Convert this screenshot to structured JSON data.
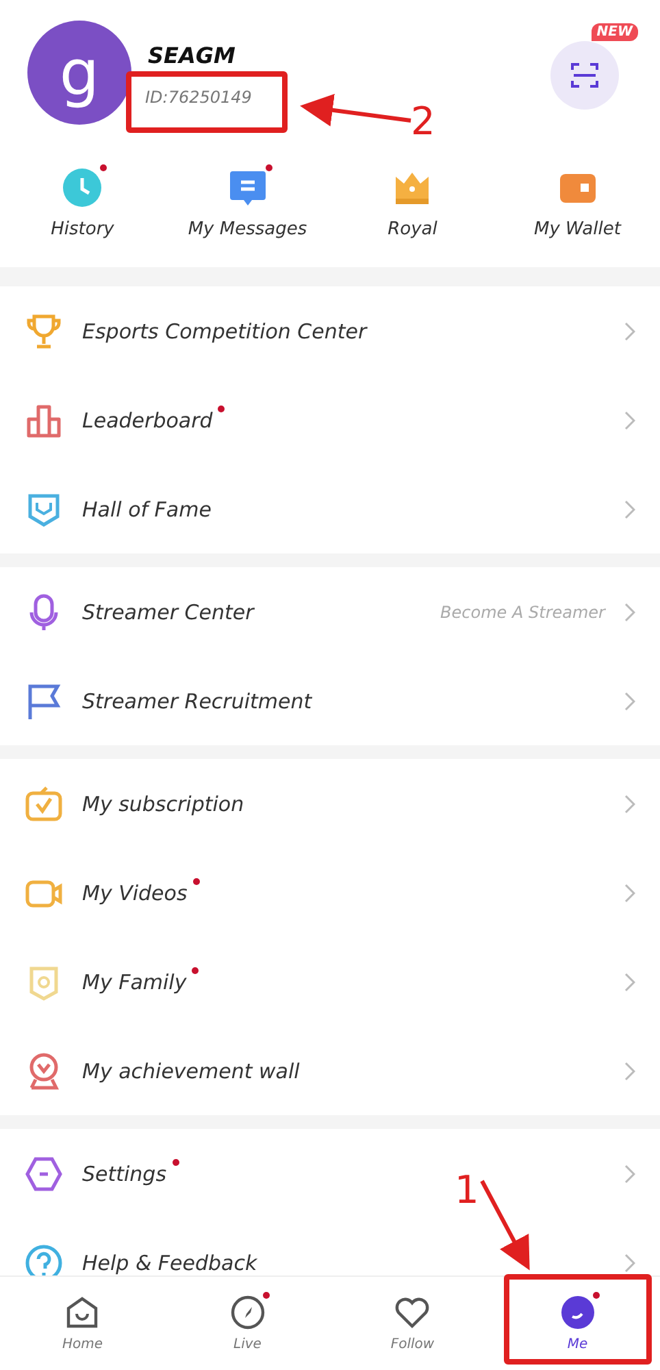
{
  "profile": {
    "avatar_letter": "g",
    "name": "SEAGM",
    "id": "ID:76250149",
    "scan_badge": "NEW"
  },
  "quick_actions": [
    {
      "label": "History",
      "dot": true
    },
    {
      "label": "My Messages",
      "dot": true
    },
    {
      "label": "Royal",
      "dot": false
    },
    {
      "label": "My Wallet",
      "dot": false
    }
  ],
  "menu_groups": [
    {
      "items": [
        {
          "label": "Esports Competition Center",
          "dot": false
        },
        {
          "label": "Leaderboard",
          "dot": true
        },
        {
          "label": "Hall of Fame",
          "dot": false
        }
      ]
    },
    {
      "items": [
        {
          "label": "Streamer Center",
          "dot": false,
          "hint": "Become A Streamer"
        },
        {
          "label": "Streamer Recruitment",
          "dot": false
        }
      ]
    },
    {
      "items": [
        {
          "label": "My subscription",
          "dot": false
        },
        {
          "label": "My Videos",
          "dot": true
        },
        {
          "label": "My Family",
          "dot": true
        },
        {
          "label": "My achievement wall",
          "dot": false
        }
      ]
    },
    {
      "items": [
        {
          "label": "Settings",
          "dot": true
        },
        {
          "label": "Help & Feedback",
          "dot": false
        }
      ]
    }
  ],
  "bottom_nav": [
    {
      "label": "Home",
      "selected": false,
      "dot": false
    },
    {
      "label": "Live",
      "selected": false,
      "dot": true
    },
    {
      "label": "Follow",
      "selected": false,
      "dot": false
    },
    {
      "label": "Me",
      "selected": true,
      "dot": true
    }
  ],
  "annotations": [
    {
      "label": "2"
    },
    {
      "label": "1"
    }
  ]
}
